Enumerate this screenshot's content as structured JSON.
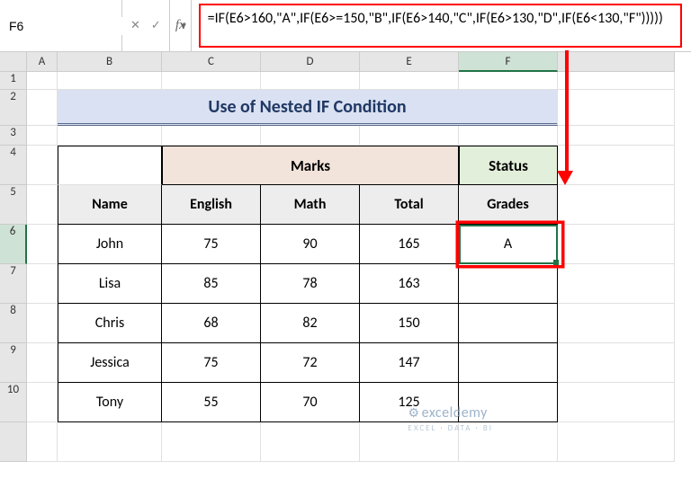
{
  "name_box": "F6",
  "fx_label": "fx",
  "formula": "=IF(E6>160,\"A\",IF(E6>=150,\"B\",IF(E6>140,\"C\",IF(E6>130,\"D\",IF(E6<130,\"F\")))))",
  "columns": [
    "A",
    "B",
    "C",
    "D",
    "E",
    "F"
  ],
  "active_col": "F",
  "rows": [
    "1",
    "2",
    "3",
    "4",
    "5",
    "6",
    "7",
    "8",
    "9",
    "10"
  ],
  "active_row": "6",
  "title": "Use of Nested IF Condition",
  "headers": {
    "marks": "Marks",
    "status": "Status",
    "name": "Name",
    "english": "English",
    "math": "Math",
    "total": "Total",
    "grades": "Grades"
  },
  "data_rows": [
    {
      "name": "John",
      "english": "75",
      "math": "90",
      "total": "165",
      "grade": "A"
    },
    {
      "name": "Lisa",
      "english": "85",
      "math": "78",
      "total": "163",
      "grade": ""
    },
    {
      "name": "Chris",
      "english": "68",
      "math": "82",
      "total": "150",
      "grade": ""
    },
    {
      "name": "Jessica",
      "english": "75",
      "math": "72",
      "total": "147",
      "grade": ""
    },
    {
      "name": "Tony",
      "english": "55",
      "math": "70",
      "total": "125",
      "grade": ""
    }
  ],
  "watermark": {
    "line1": "exceldemy",
    "line2": "EXCEL · DATA · BI"
  }
}
